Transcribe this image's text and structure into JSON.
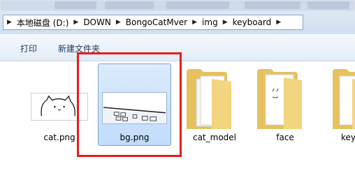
{
  "address": {
    "segments": [
      "本地磁盘 (D:)",
      "DOWN",
      "BongoCatMver",
      "img",
      "keyboard"
    ]
  },
  "toolbar": {
    "print_label": "打印",
    "new_folder_label": "新建文件夹"
  },
  "files": [
    {
      "name": "cat.png",
      "type": "image",
      "icon": "cat-image-icon"
    },
    {
      "name": "bg.png",
      "type": "image",
      "icon": "keyboard-image-icon",
      "selected": true
    },
    {
      "name": "cat_model",
      "type": "folder",
      "icon": "folder-icon"
    },
    {
      "name": "face",
      "type": "folder",
      "icon": "folder-icon"
    },
    {
      "name": "key",
      "type": "folder",
      "icon": "folder-icon"
    }
  ],
  "colors": {
    "highlight_box": "#e31d1d",
    "selection_fill": "#cce4fb",
    "folder_yellow": "#f2d27a"
  }
}
